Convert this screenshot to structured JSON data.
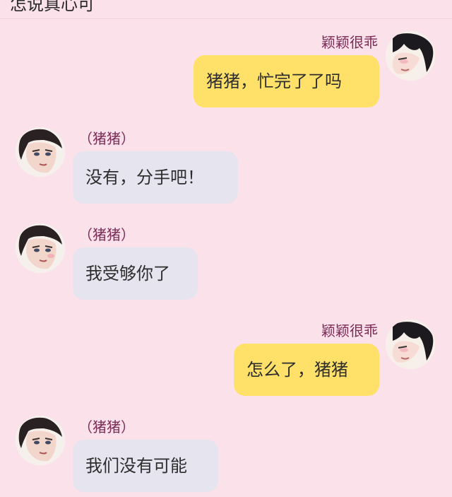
{
  "header": {
    "partial_text": "怎说真心可"
  },
  "messages": [
    {
      "side": "right",
      "name": "颖颖很乖",
      "text": "猪猪，忙完了了吗",
      "bubble_color": "#ffe16a"
    },
    {
      "side": "left",
      "name": "（猪猪）",
      "text": "没有，分手吧！",
      "bubble_color": "#e6e4ee"
    },
    {
      "side": "left",
      "name": "（猪猪）",
      "text": "我受够你了",
      "bubble_color": "#e6e4ee"
    },
    {
      "side": "right",
      "name": "颖颖很乖",
      "text": "怎么了，猪猪",
      "bubble_color": "#ffe16a"
    },
    {
      "side": "left",
      "name": "（猪猪）",
      "text": "我们没有可能",
      "bubble_color": "#e6e4ee"
    }
  ],
  "colors": {
    "background": "#fbe1ea",
    "name_color": "#7a2c57",
    "right_bubble": "#ffe16a",
    "left_bubble": "#e6e4ee"
  },
  "icons": {
    "right_avatar": "female-avatar-icon",
    "left_avatar": "male-avatar-icon"
  }
}
